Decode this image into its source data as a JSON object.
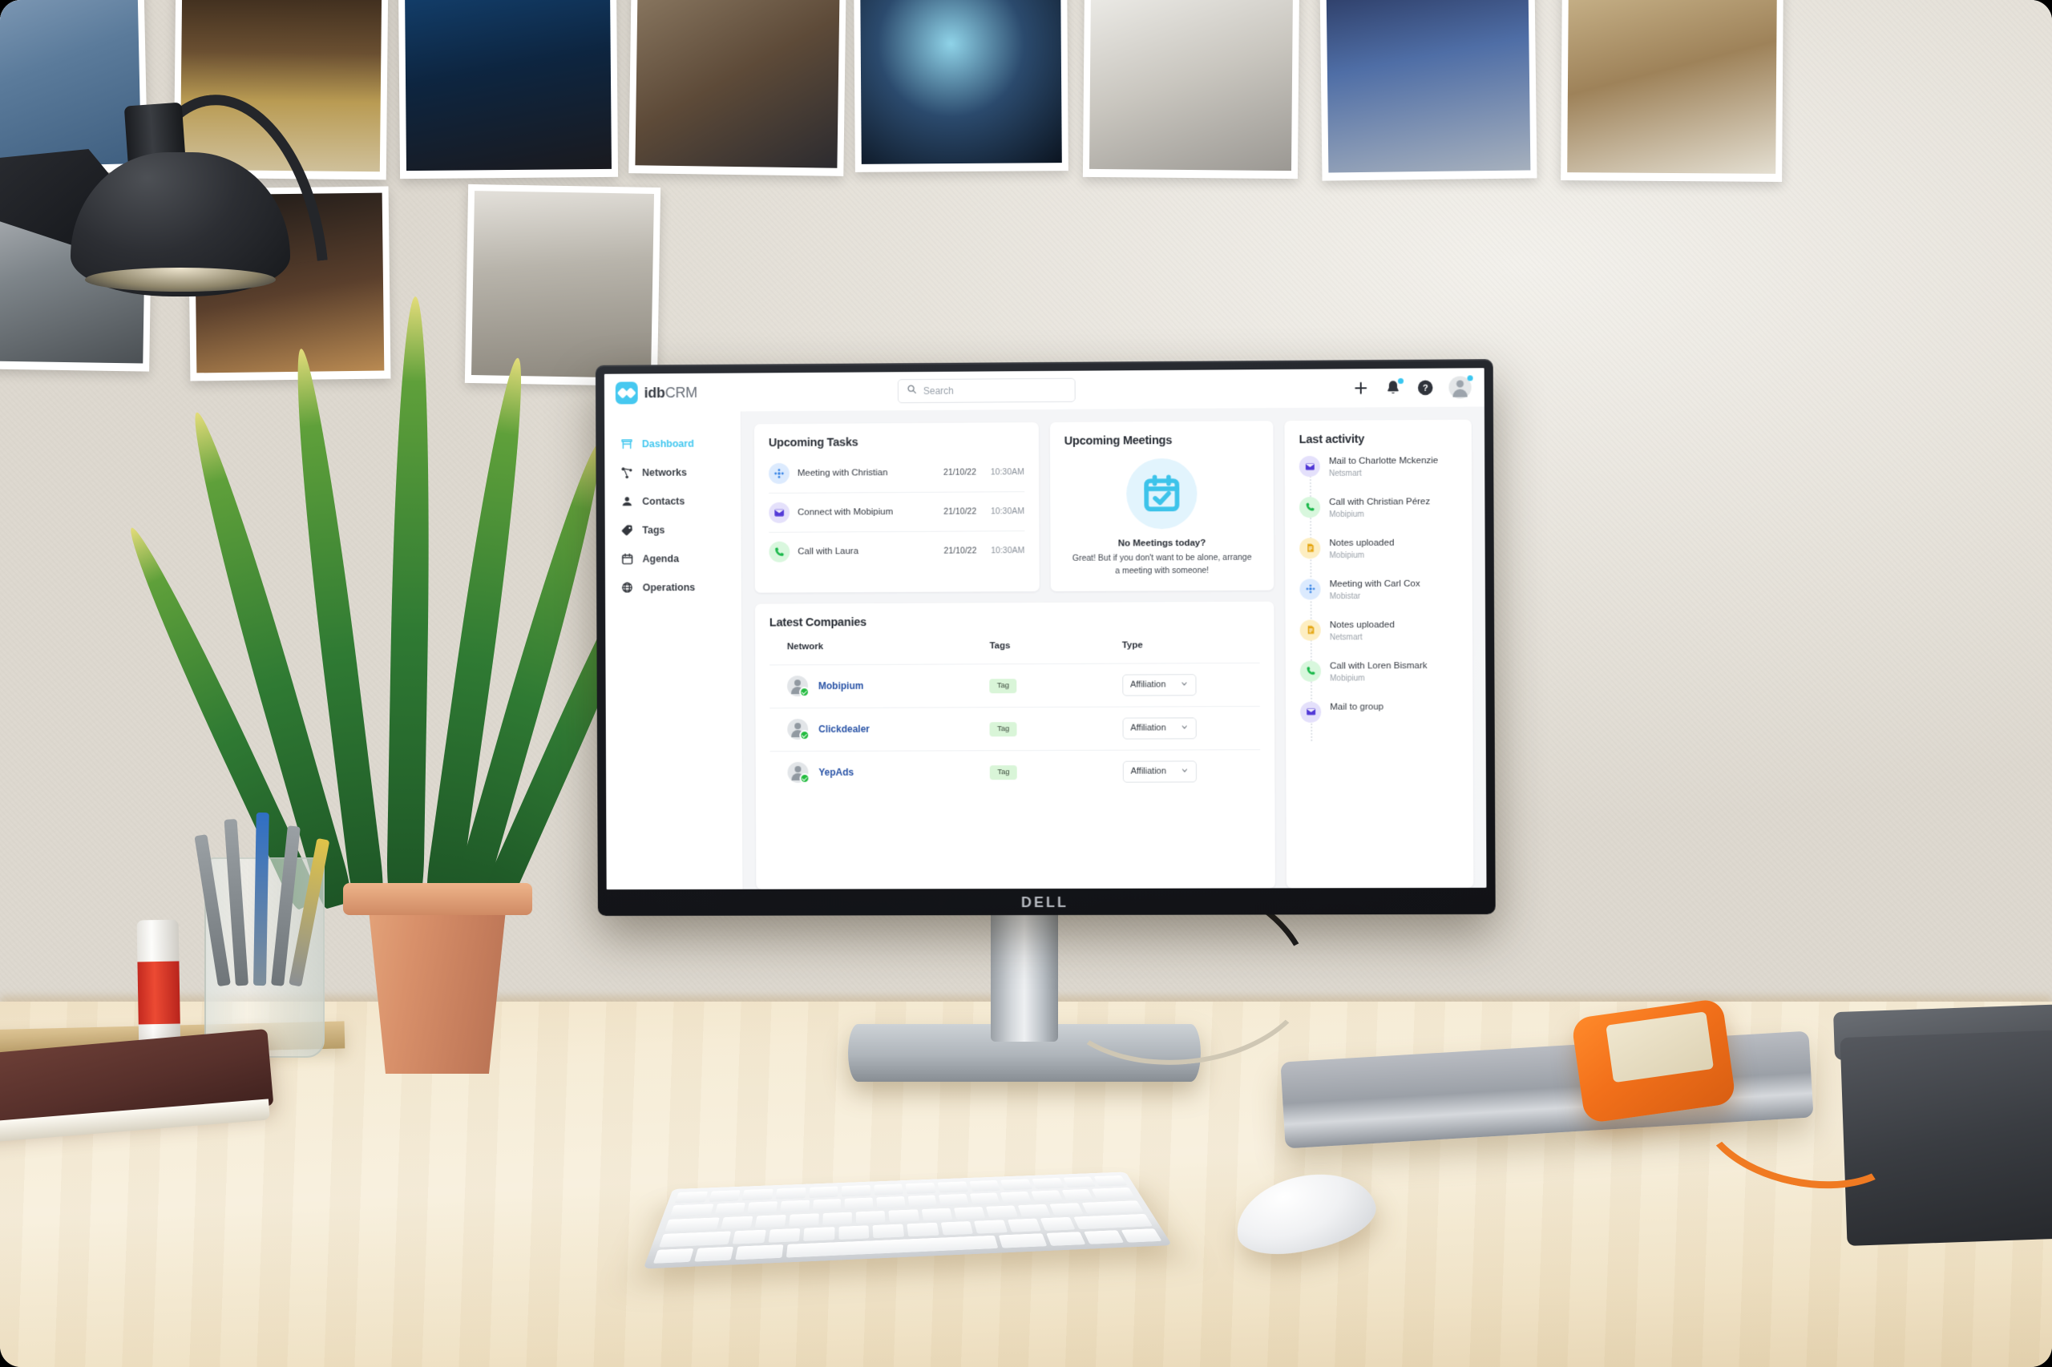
{
  "scene": {
    "monitor_brand": "DELL"
  },
  "app": {
    "brand": {
      "name_bold": "idb",
      "name_light": "CRM"
    },
    "search": {
      "placeholder": "Search",
      "value": ""
    },
    "topbar_icons": [
      {
        "name": "add-icon",
        "label": "+"
      },
      {
        "name": "notifications-icon",
        "label": ""
      },
      {
        "name": "help-icon",
        "label": ""
      },
      {
        "name": "user-avatar",
        "label": ""
      }
    ],
    "sidebar": {
      "items": [
        {
          "label": "Dashboard",
          "icon": "dashboard-icon",
          "active": true
        },
        {
          "label": "Networks",
          "icon": "networks-icon",
          "active": false
        },
        {
          "label": "Contacts",
          "icon": "contacts-icon",
          "active": false
        },
        {
          "label": "Tags",
          "icon": "tags-icon",
          "active": false
        },
        {
          "label": "Agenda",
          "icon": "agenda-icon",
          "active": false
        },
        {
          "label": "Operations",
          "icon": "operations-icon",
          "active": false
        }
      ]
    },
    "tasks": {
      "title": "Upcoming Tasks",
      "items": [
        {
          "name": "Meeting with Christian",
          "date": "21/10/22",
          "time": "10:30AM",
          "icon": "meeting-group-icon",
          "color": "blue"
        },
        {
          "name": "Connect with Mobipium",
          "date": "21/10/22",
          "time": "10:30AM",
          "icon": "mail-icon",
          "color": "purple"
        },
        {
          "name": "Call with Laura",
          "date": "21/10/22",
          "time": "10:30AM",
          "icon": "phone-icon",
          "color": "green"
        }
      ]
    },
    "meetings": {
      "title": "Upcoming Meetings",
      "empty_title": "No Meetings today?",
      "empty_desc": "Great! But if you don't want to be alone, arrange a meeting with someone!",
      "illustration": "calendar-check-icon"
    },
    "companies": {
      "title": "Latest Companies",
      "columns": [
        "Network",
        "Tags",
        "Type"
      ],
      "rows": [
        {
          "network": "Mobipium",
          "tag": "Tag",
          "type": "Affiliation",
          "verified": true
        },
        {
          "network": "Clickdealer",
          "tag": "Tag",
          "type": "Affiliation",
          "verified": true
        },
        {
          "network": "YepAds",
          "tag": "Tag",
          "type": "Affiliation",
          "verified": true
        }
      ]
    },
    "activity": {
      "title": "Last activity",
      "items": [
        {
          "title": "Mail to Charlotte Mckenzie",
          "sub": "Netsmart",
          "icon": "mail-icon",
          "color": "purple"
        },
        {
          "title": "Call with Christian Pérez",
          "sub": "Mobipium",
          "icon": "phone-icon",
          "color": "green"
        },
        {
          "title": "Notes uploaded",
          "sub": "Mobipium",
          "icon": "notes-icon",
          "color": "yellow"
        },
        {
          "title": "Meeting with Carl Cox",
          "sub": "Mobistar",
          "icon": "meeting-group-icon",
          "color": "blue"
        },
        {
          "title": "Notes uploaded",
          "sub": "Netsmart",
          "icon": "notes-icon",
          "color": "yellow"
        },
        {
          "title": "Call with Loren Bismark",
          "sub": "Mobipium",
          "icon": "phone-icon",
          "color": "green"
        },
        {
          "title": "Mail to group",
          "sub": "",
          "icon": "mail-icon",
          "color": "purple"
        }
      ]
    }
  },
  "colors": {
    "brand_cyan": "#34c3ee",
    "link_blue": "#2953a6",
    "tag_green_bg": "#d9f5d8",
    "verified_green": "#23bb3f",
    "page_bg": "#f4f5f7"
  }
}
